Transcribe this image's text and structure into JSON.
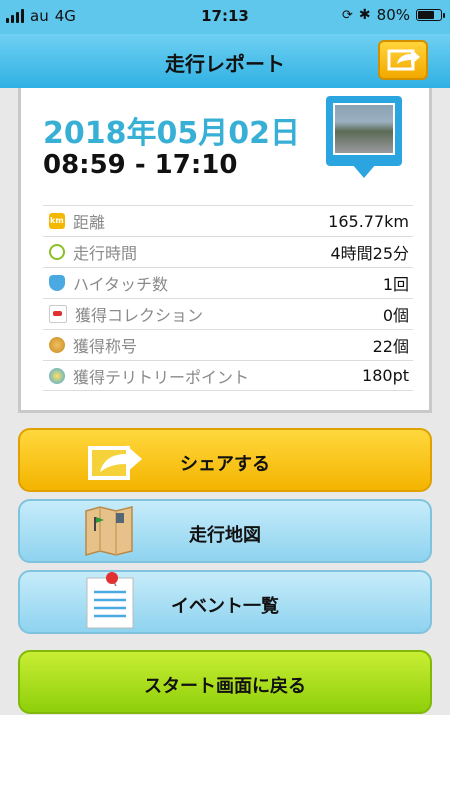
{
  "status_bar": {
    "carrier": "au",
    "network": "4G",
    "time": "17:13",
    "battery": "80%",
    "battery_level": 0.8
  },
  "header": {
    "title": "走行レポート",
    "share_icon": "share-arrow-icon"
  },
  "report": {
    "date": "2018年05月02日",
    "time_range": "08:59 - 17:10",
    "photo_icon": "photo-pin-icon"
  },
  "stats": [
    {
      "icon": "km-icon",
      "label": "距離",
      "value": "165.77km"
    },
    {
      "icon": "clock-icon",
      "label": "走行時間",
      "value": "4時間25分"
    },
    {
      "icon": "hand-icon",
      "label": "ハイタッチ数",
      "value": "1回"
    },
    {
      "icon": "car-icon",
      "label": "獲得コレクション",
      "value": "0個"
    },
    {
      "icon": "medal-icon",
      "label": "獲得称号",
      "value": "22個"
    },
    {
      "icon": "point-icon",
      "label": "獲得テリトリーポイント",
      "value": "180pt"
    }
  ],
  "buttons": {
    "share": "シェアする",
    "map": "走行地図",
    "events": "イベント一覧",
    "start": "スタート画面に戻る"
  },
  "colors": {
    "header": "#2fb1e3",
    "date_text": "#38b0d6",
    "share_button": "#f4b400",
    "map_button": "#8fd3ef",
    "start_button": "#8fcf0a"
  }
}
